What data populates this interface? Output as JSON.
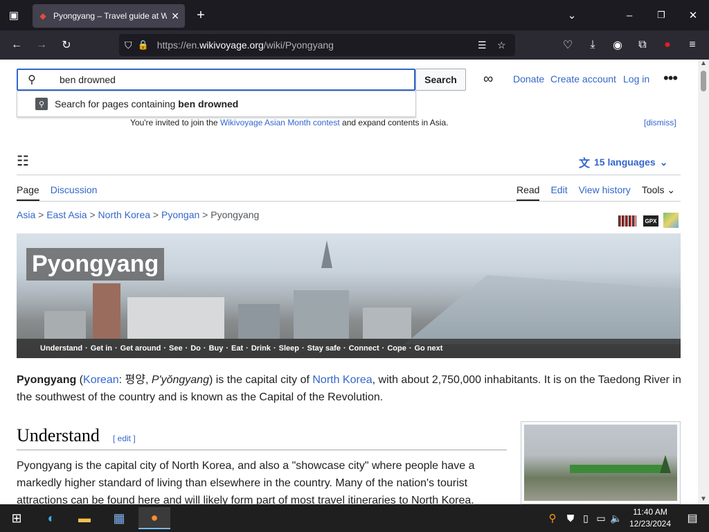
{
  "browser": {
    "tab_title": "Pyongyang – Travel guide at Wi",
    "url_prefix": "https://en.",
    "url_host": "wikivoyage.org",
    "url_path": "/wiki/Pyongyang"
  },
  "search": {
    "value": "ben drowned",
    "button_label": "Search",
    "suggestion_prefix": "Search for pages containing ",
    "suggestion_term": "ben drowned"
  },
  "header": {
    "donate": "Donate",
    "create_account": "Create account",
    "log_in": "Log in"
  },
  "banner": {
    "text_before": "You're invited to join the ",
    "link": "Wikivoyage Asian Month contest",
    "text_after": " and expand contents in Asia.",
    "dismiss": "[dismiss]"
  },
  "languages": "15 languages",
  "tabs_left": [
    "Page",
    "Discussion"
  ],
  "tabs_right": [
    "Read",
    "Edit",
    "View history",
    "Tools"
  ],
  "breadcrumbs": [
    "Asia",
    "East Asia",
    "North Korea",
    "Pyongan",
    "Pyongyang"
  ],
  "hero": {
    "title": "Pyongyang",
    "toc": [
      "Understand",
      "Get in",
      "Get around",
      "See",
      "Do",
      "Buy",
      "Eat",
      "Drink",
      "Sleep",
      "Stay safe",
      "Connect",
      "Cope",
      "Go next"
    ]
  },
  "lead": {
    "bold": "Pyongyang",
    "korean_link": "Korean",
    "korean_text": ": 평양, ",
    "romanized": "P'yŏngyang",
    "text1": ") is the capital city of ",
    "nk_link": "North Korea",
    "text2": ", with about 2,750,000 inhabitants. It is on the Taedong River in the southwest of the country and is known as the Capital of the Revolution."
  },
  "section": {
    "heading": "Understand",
    "edit": "[ edit ]",
    "paragraph": "Pyongyang is the capital city of North Korea, and also a \"showcase city\" where people have a markedly higher standard of living than elsewhere in the country. Many of the nation's tourist attractions can be found here and will likely form part of most travel itineraries to North Korea."
  },
  "icons": {
    "gpx": "GPX"
  },
  "taskbar": {
    "time": "11:40 AM",
    "date": "12/23/2024"
  }
}
